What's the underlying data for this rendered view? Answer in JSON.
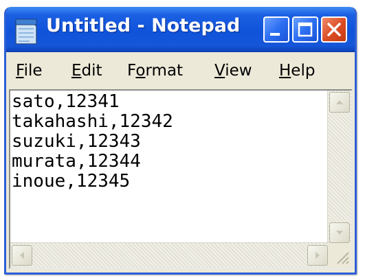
{
  "window": {
    "title": "Untitled - Notepad",
    "accent_color": "#1b5fe2",
    "close_color": "#db4b22"
  },
  "titlebar": {
    "app_icon": "notepad-icon",
    "buttons": [
      "minimize-icon",
      "maximize-icon",
      "close-icon"
    ]
  },
  "menu": {
    "file": {
      "pre": "",
      "accel": "F",
      "post": "ile"
    },
    "edit": {
      "pre": "",
      "accel": "E",
      "post": "dit"
    },
    "format": {
      "pre": "F",
      "accel": "o",
      "post": "rmat"
    },
    "view": {
      "pre": "",
      "accel": "V",
      "post": "iew"
    },
    "help": {
      "pre": "",
      "accel": "H",
      "post": "elp"
    }
  },
  "document": {
    "lines": [
      "sato,12341",
      "takahashi,12342",
      "suzuki,12343",
      "murata,12344",
      "inoue,12345"
    ]
  },
  "scrollbars": {
    "vertical_arrows": [
      "scroll-up-arrow-icon",
      "scroll-down-arrow-icon"
    ],
    "horizontal_arrows": [
      "scroll-left-arrow-icon",
      "scroll-right-arrow-icon"
    ],
    "size_grip": "size-grip-icon"
  }
}
